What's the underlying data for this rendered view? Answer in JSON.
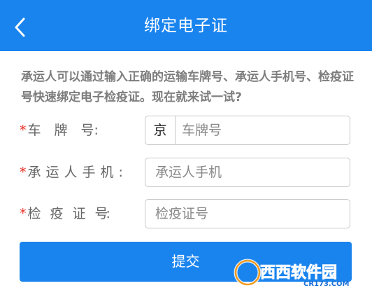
{
  "header": {
    "title": "绑定电子证",
    "back_icon": "chevron-left-icon"
  },
  "description": "承运人可以通过输入正确的运输车牌号、承运人手机号、检疫证号快速绑定电子检疫证。现在就来试一试?",
  "form": {
    "required_mark": "*",
    "plate": {
      "label": "车　牌　号:",
      "prefix": "京",
      "placeholder": "车牌号"
    },
    "phone": {
      "label": "承运人手机:",
      "placeholder": "承运人手机"
    },
    "cert": {
      "label": "检　疫　证　号:",
      "placeholder": "检疫证号"
    }
  },
  "submit_label": "提交",
  "watermark": {
    "brand": "西西软件园",
    "site": "CR173.COM"
  },
  "colors": {
    "primary": "#1a84ee",
    "required": "#e8322a"
  }
}
